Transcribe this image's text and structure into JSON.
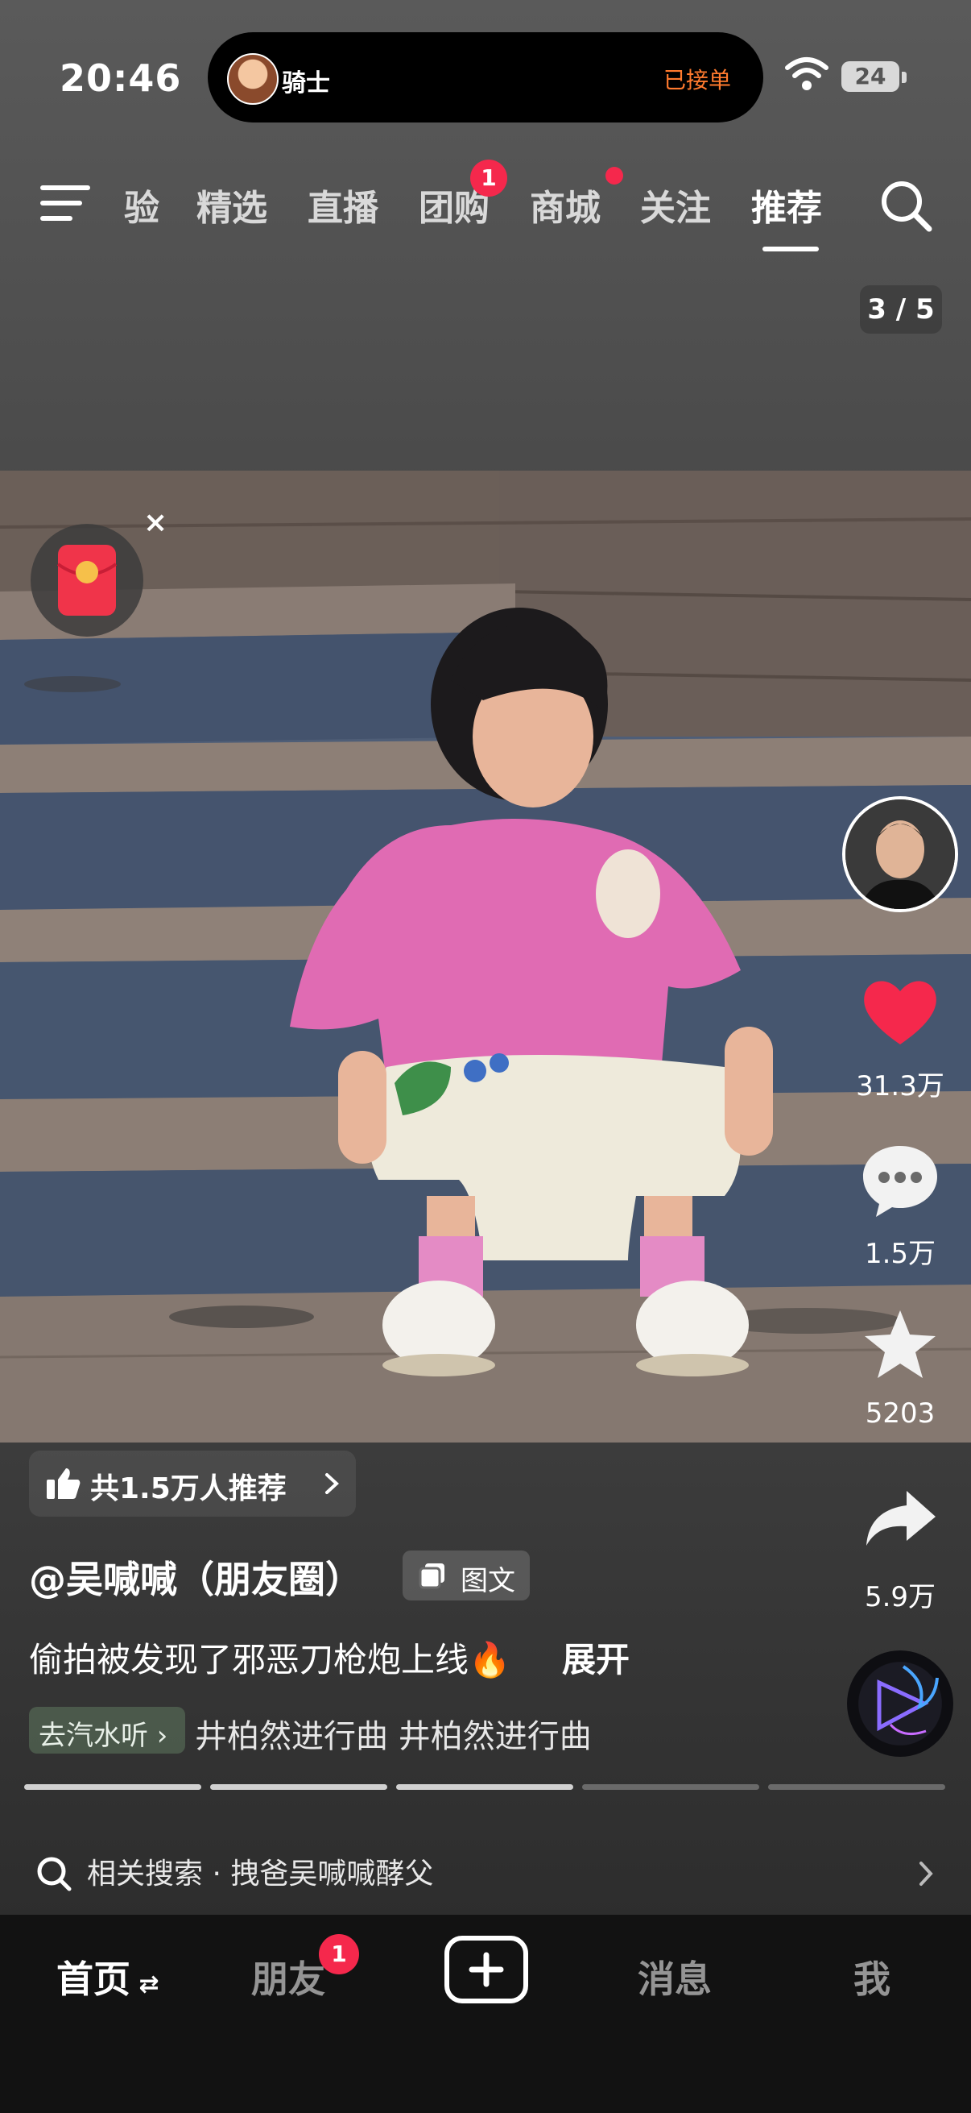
{
  "status_bar": {
    "time": "20:46",
    "island_name": "骑士",
    "island_status": "已接单",
    "battery": "24"
  },
  "top_nav": {
    "tabs": [
      "验",
      "精选",
      "直播",
      "团购",
      "商城",
      "关注",
      "推荐"
    ],
    "active_tab": "推荐",
    "group_buy_badge": "1"
  },
  "page_counter": "3 / 5",
  "right_rail": {
    "like_count": "31.3万",
    "comment_count": "1.5万",
    "favorite_count": "5203",
    "share_count": "5.9万"
  },
  "post": {
    "recommend_text": "共1.5万人推荐",
    "author": "@吴喊喊（朋友圈）",
    "type_badge": "图文",
    "caption": "偷拍被发现了邪恶刀枪炮上线🔥",
    "expand": "展开",
    "music_pill": "去汽水听",
    "music_track": "井柏然进行曲  井柏然进行曲"
  },
  "progress": {
    "total": 5,
    "done": 3
  },
  "related_search": {
    "label": "相关搜索 · 拽爸吴喊喊酵父"
  },
  "bottom_tabs": {
    "home": "首页",
    "friends": "朋友",
    "friends_badge": "1",
    "messages": "消息",
    "me": "我"
  },
  "colors": {
    "accent_red": "#f5284c",
    "badge_orange": "#ff7a2e"
  }
}
